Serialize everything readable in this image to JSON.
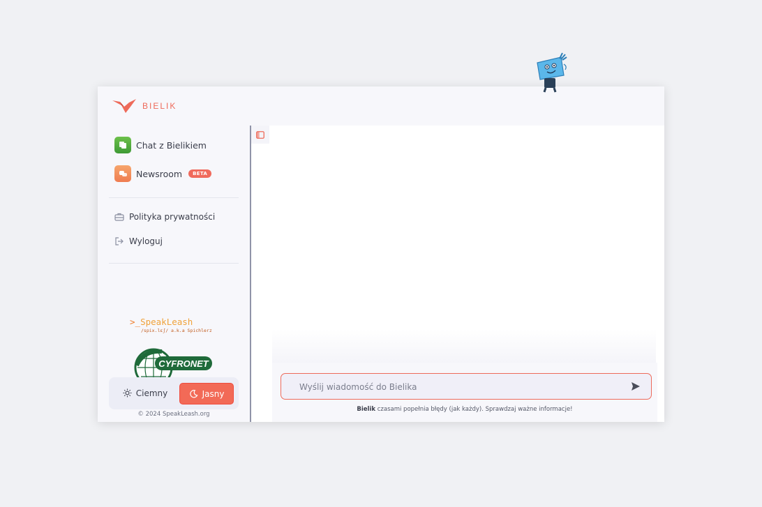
{
  "brand": {
    "name": "BIELIK",
    "accent_color": "#ee6a5a"
  },
  "sidebar": {
    "nav": [
      {
        "label": "Chat z Bielikiem",
        "icon": "chat-icon"
      },
      {
        "label": "Newsroom",
        "icon": "newsroom-icon",
        "badge": "BETA"
      }
    ],
    "links": [
      {
        "label": "Polityka prywatności",
        "icon": "briefcase-icon"
      },
      {
        "label": "Wyloguj",
        "icon": "logout-icon"
      }
    ],
    "partners": {
      "speakleash": {
        "title": "SpeakLeash",
        "prompt": ">_",
        "subtitle": "/spix.lɛʃ/ a.k.a Spichlerz"
      },
      "cyfronet": {
        "name": "CYFRONET"
      }
    },
    "theme": {
      "dark_label": "Ciemny",
      "light_label": "Jasny",
      "selected": "Jasny"
    },
    "copyright": "© 2024 SpeakLeash.org"
  },
  "chat": {
    "input_placeholder": "Wyślij wiadomość do Bielika",
    "disclaimer_brand": "Bielik",
    "disclaimer_text": "czasami popełnia błędy (jak każdy). Sprawdzaj ważne informacje!"
  }
}
